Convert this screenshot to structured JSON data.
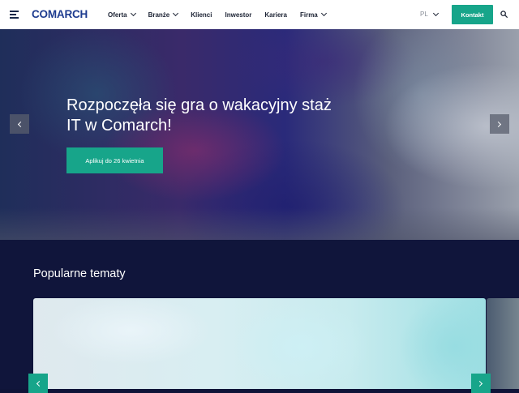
{
  "header": {
    "logo": "COMARCH",
    "nav": [
      {
        "label": "Oferta",
        "has_dropdown": true
      },
      {
        "label": "Branże",
        "has_dropdown": true
      },
      {
        "label": "Klienci",
        "has_dropdown": false
      },
      {
        "label": "Inwestor",
        "has_dropdown": false
      },
      {
        "label": "Kariera",
        "has_dropdown": false
      },
      {
        "label": "Firma",
        "has_dropdown": true
      }
    ],
    "language": "PL",
    "contact_label": "Kontakt",
    "icons": {
      "menu": "hamburger-icon",
      "search": "search-icon"
    }
  },
  "hero": {
    "title": "Rozpoczęła się gra o wakacyjny staż IT w Comarch!",
    "cta_label": "Aplikuj do 26 kwietnia",
    "icons": {
      "prev": "chevron-left-icon",
      "next": "chevron-right-icon"
    }
  },
  "topics": {
    "title": "Popularne tematy"
  },
  "colors": {
    "accent": "#17a58a",
    "brand": "#1d3b8f",
    "dark_bg": "#10153b"
  }
}
